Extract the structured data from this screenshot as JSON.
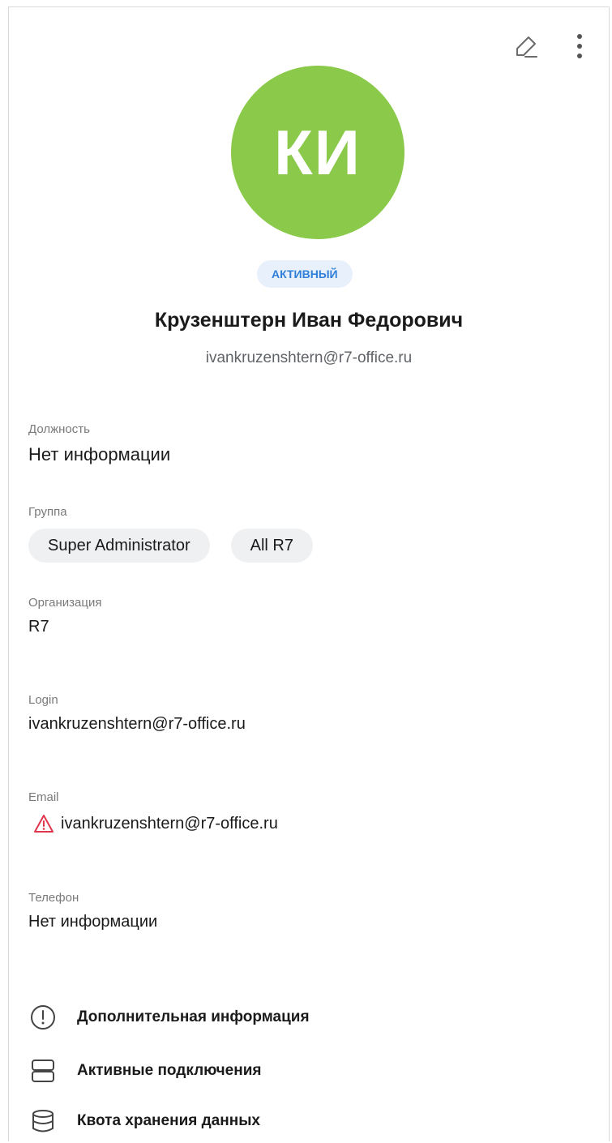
{
  "profile": {
    "initials": "КИ",
    "avatar_color": "#8bc94a",
    "status": "АКТИВНЫЙ",
    "full_name": "Крузенштерн Иван Федорович",
    "email": "ivankruzenshtern@r7-office.ru"
  },
  "fields": {
    "position": {
      "label": "Должность",
      "value": "Нет информации"
    },
    "group": {
      "label": "Группа",
      "chips": [
        "Super Administrator",
        "All R7"
      ]
    },
    "organization": {
      "label": "Организация",
      "value": "R7"
    },
    "login": {
      "label": "Login",
      "value": "ivankruzenshtern@r7-office.ru"
    },
    "email": {
      "label": "Email",
      "value": "ivankruzenshtern@r7-office.ru",
      "warning_color": "#e0364b"
    },
    "phone": {
      "label": "Телефон",
      "value": "Нет информации"
    }
  },
  "links": [
    {
      "label": "Дополнительная информация",
      "icon": "info-circle-icon"
    },
    {
      "label": "Активные подключения",
      "icon": "server-icon"
    },
    {
      "label": "Квота хранения данных",
      "icon": "database-icon"
    }
  ],
  "actions": {
    "edit_icon": "edit-pencil-icon",
    "more_icon": "more-vertical-icon"
  }
}
